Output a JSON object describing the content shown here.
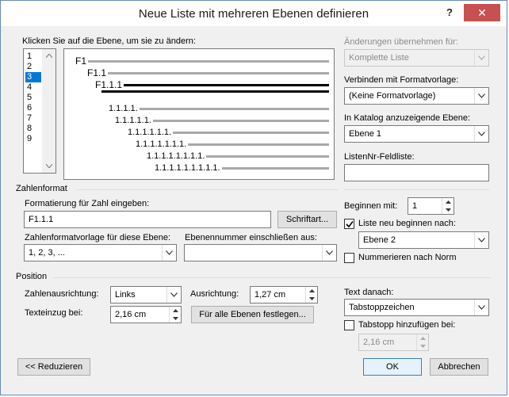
{
  "window": {
    "title": "Neue Liste mit mehreren Ebenen definieren",
    "help": "?",
    "close": "✕"
  },
  "levels": {
    "label": "Klicken Sie auf die Ebene, um sie zu ändern:",
    "items": [
      "1",
      "2",
      "3",
      "4",
      "5",
      "6",
      "7",
      "8",
      "9"
    ],
    "selected": "3"
  },
  "preview": {
    "rows": [
      "F1",
      "F1.1",
      "F1.1.1",
      "",
      "1.1.1.1.",
      "1.1.1.1.1.",
      "1.1.1.1.1.1.",
      "1.1.1.1.1.1.1.",
      "1.1.1.1.1.1.1.1.",
      "1.1.1.1.1.1.1.1.1."
    ]
  },
  "right_top": {
    "apply_label": "Änderungen übernehmen für:",
    "apply_value": "Komplette Liste",
    "link_label": "Verbinden mit Formatvorlage:",
    "link_value": "(Keine Formatvorlage)",
    "gallery_label": "In Katalog anzuzeigende Ebene:",
    "gallery_value": "Ebene 1",
    "listnum_label": "ListenNr-Feldliste:",
    "listnum_value": ""
  },
  "number_format": {
    "group": "Zahlenformat",
    "format_label": "Formatierung für Zahl eingeben:",
    "format_value": "F1.1.1",
    "font_button": "Schriftart...",
    "style_label": "Zahlenformatvorlage für diese Ebene:",
    "style_value": "1, 2, 3, ...",
    "include_label": "Ebenennummer einschließen aus:",
    "include_value": "",
    "start_label": "Beginnen mit:",
    "start_value": "1",
    "restart_label": "Liste neu beginnen nach:",
    "restart_value": "Ebene 2",
    "legal_label": "Nummerieren nach Norm"
  },
  "position": {
    "group": "Position",
    "align_label": "Zahlenausrichtung:",
    "align_value": "Links",
    "alignat_label": "Ausrichtung:",
    "alignat_value": "1,27 cm",
    "indent_label": "Texteinzug bei:",
    "indent_value": "2,16 cm",
    "all_levels_button": "Für alle Ebenen festlegen...",
    "follow_label": "Text danach:",
    "follow_value": "Tabstoppzeichen",
    "tab_label": "Tabstopp hinzufügen bei:",
    "tab_value": "2,16 cm"
  },
  "footer": {
    "less_button": "<< Reduzieren",
    "ok_button": "OK",
    "cancel_button": "Abbrechen"
  }
}
